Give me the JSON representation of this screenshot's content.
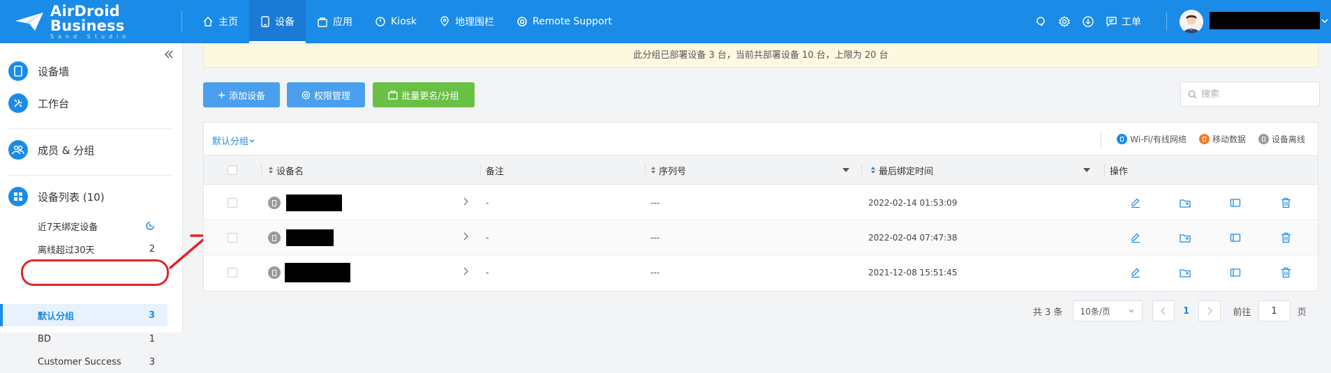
{
  "header": {
    "logo_main": "AirDroid Business",
    "logo_sub": "Sand Studio",
    "nav": [
      {
        "label": "主页",
        "icon": "home-icon"
      },
      {
        "label": "设备",
        "icon": "phone-icon",
        "active": true
      },
      {
        "label": "应用",
        "icon": "bag-icon"
      },
      {
        "label": "Kiosk",
        "icon": "kiosk-icon"
      },
      {
        "label": "地理围栏",
        "icon": "map-pin-icon"
      },
      {
        "label": "Remote Support",
        "icon": "lifebuoy-icon"
      }
    ],
    "ticket_label": "工单",
    "accent": "#1b8be8"
  },
  "sidebar": {
    "device_wall": "设备墙",
    "workbench": "工作台",
    "members": "成员 & 分组",
    "device_list": "设备列表 (10)",
    "groups": [
      {
        "label": "近7天绑定设备",
        "count": ""
      },
      {
        "label": "离线超过30天",
        "count": "2"
      },
      {
        "label": "默认分组",
        "count": "3",
        "active": true
      },
      {
        "label": "BD",
        "count": "1"
      },
      {
        "label": "Customer Success",
        "count": "3"
      }
    ]
  },
  "banner": {
    "text": "此分组已部署设备 3 台，当前共部署设备 10 台，上限为 20 台"
  },
  "toolbar": {
    "add_device": "添加设备",
    "permissions": "权限管理",
    "batch_rename": "批量更名/分组",
    "search_placeholder": "搜索"
  },
  "table": {
    "group_selector": "默认分组",
    "legend": [
      "Wi-Fi/有线网络",
      "移动数据",
      "设备离线"
    ],
    "legend_colors": [
      "#1b8be8",
      "#f07b2a",
      "#9a9a9a"
    ],
    "columns": {
      "name": "设备名",
      "note": "备注",
      "serial": "序列号",
      "bind_time": "最后绑定时间",
      "actions": "操作"
    },
    "rows": [
      {
        "note": "-",
        "serial": "---",
        "bind_time": "2022-02-14 01:53:09"
      },
      {
        "note": "-",
        "serial": "---",
        "bind_time": "2022-02-04 07:47:38"
      },
      {
        "note": "-",
        "serial": "---",
        "bind_time": "2021-12-08 15:51:45"
      }
    ]
  },
  "pagination": {
    "total": "共 3 条",
    "page_size": "10条/页",
    "current": "1",
    "goto_label": "前往",
    "goto_value": "1",
    "page_suffix": "页"
  }
}
